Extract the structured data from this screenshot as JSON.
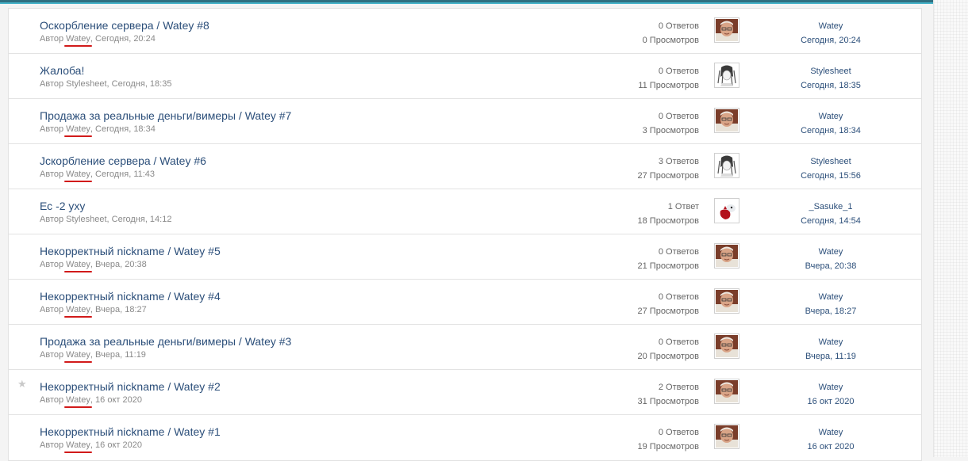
{
  "threads": [
    {
      "title": "Оскорбление сервера / Watey #8",
      "by_prefix": "Автор",
      "author": "Watey",
      "date": "Сегодня, 20:24",
      "replies": "0 Ответов",
      "views": "0 Просмотров",
      "avatar": "watey-avatar",
      "last_user": "Watey",
      "last_date": "Сегодня, 20:24",
      "underlined": true,
      "star": ""
    },
    {
      "title": "Жалоба!",
      "by_prefix": "Автор",
      "author": "Stylesheet",
      "date": "Сегодня, 18:35",
      "replies": "0 Ответов",
      "views": "11 Просмотров",
      "avatar": "stylesheet-avatar",
      "last_user": "Stylesheet",
      "last_date": "Сегодня, 18:35",
      "underlined": false,
      "star": ""
    },
    {
      "title": "Продажа за реальные деньги/вимеры / Watey #7",
      "by_prefix": "Автор",
      "author": "Watey",
      "date": "Сегодня, 18:34",
      "replies": "0 Ответов",
      "views": "3 Просмотров",
      "avatar": "watey-avatar",
      "last_user": "Watey",
      "last_date": "Сегодня, 18:34",
      "underlined": true,
      "star": ""
    },
    {
      "title": "Jcкорбление сервера / Watey #6",
      "by_prefix": "Автор",
      "author": "Watey",
      "date": "Сегодня, 11:43",
      "replies": "3 Ответов",
      "views": "27 Просмотров",
      "avatar": "stylesheet-avatar",
      "last_user": "Stylesheet",
      "last_date": "Сегодня, 15:56",
      "underlined": true,
      "star": ""
    },
    {
      "title": "Ес -2 уху",
      "by_prefix": "Автор",
      "author": "Stylesheet",
      "date": "Сегодня, 14:12",
      "replies": "1 Ответ",
      "views": "18 Просмотров",
      "avatar": "sasuke-avatar",
      "last_user": "_Sasuke_1",
      "last_date": "Сегодня, 14:54",
      "underlined": false,
      "star": ""
    },
    {
      "title": "Некорректный nickname / Watey #5",
      "by_prefix": "Автор",
      "author": "Watey",
      "date": "Вчера, 20:38",
      "replies": "0 Ответов",
      "views": "21 Просмотров",
      "avatar": "watey-avatar",
      "last_user": "Watey",
      "last_date": "Вчера, 20:38",
      "underlined": true,
      "star": ""
    },
    {
      "title": "Некорректный nickname / Watey #4",
      "by_prefix": "Автор",
      "author": "Watey",
      "date": "Вчера, 18:27",
      "replies": "0 Ответов",
      "views": "27 Просмотров",
      "avatar": "watey-avatar",
      "last_user": "Watey",
      "last_date": "Вчера, 18:27",
      "underlined": true,
      "star": ""
    },
    {
      "title": "Продажа за реальные деньги/вимеры / Watey #3",
      "by_prefix": "Автор",
      "author": "Watey",
      "date": "Вчера, 11:19",
      "replies": "0 Ответов",
      "views": "20 Просмотров",
      "avatar": "watey-avatar",
      "last_user": "Watey",
      "last_date": "Вчера, 11:19",
      "underlined": true,
      "star": ""
    },
    {
      "title": "Некорректный nickname / Watey #2",
      "by_prefix": "Автор",
      "author": "Watey",
      "date": "16 окт 2020",
      "replies": "2 Ответов",
      "views": "31 Просмотров",
      "avatar": "watey-avatar",
      "last_user": "Watey",
      "last_date": "16 окт 2020",
      "underlined": true,
      "star": "★"
    },
    {
      "title": "Некорректный nickname / Watey #1",
      "by_prefix": "Автор",
      "author": "Watey",
      "date": "16 окт 2020",
      "replies": "0 Ответов",
      "views": "19 Просмотров",
      "avatar": "watey-avatar",
      "last_user": "Watey",
      "last_date": "16 окт 2020",
      "underlined": true,
      "star": ""
    }
  ],
  "colors": {
    "link": "#2c4f7a",
    "meta": "#8a8a8a",
    "annotation_underline": "#d11a1a",
    "top_bar": "#2f6f80",
    "top_bar_accent": "#46b3c9"
  }
}
